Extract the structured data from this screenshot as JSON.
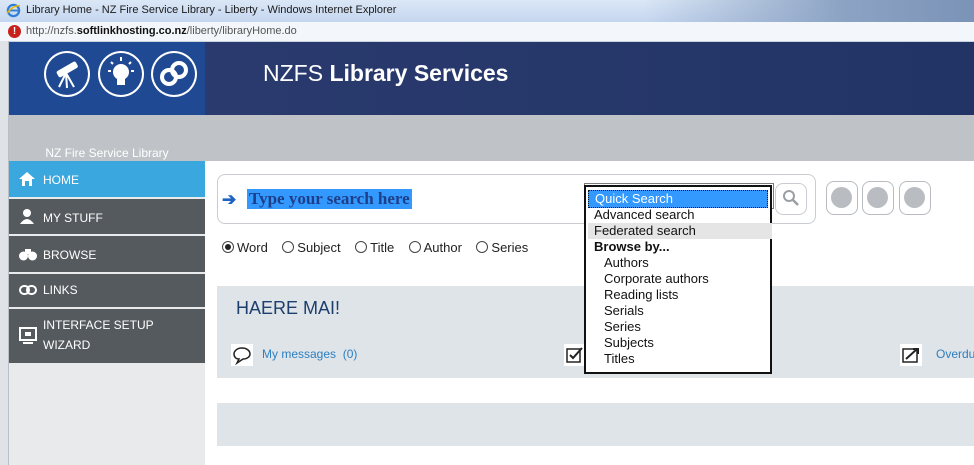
{
  "window": {
    "title": "Library Home - NZ Fire Service Library - Liberty - Windows Internet Explorer",
    "url_prefix": "http://nzfs.",
    "url_domain": "softlinkhosting.co.nz",
    "url_path": "/liberty/libraryHome.do"
  },
  "header": {
    "brand_prefix": "NZFS",
    "brand_main": "Library Services",
    "library_name": "NZ Fire Service Library",
    "logo_icons": [
      "telescope-icon",
      "lightbulb-icon",
      "link-icon"
    ]
  },
  "sidebar": {
    "items": [
      {
        "label": "HOME",
        "icon": "home-icon",
        "active": true
      },
      {
        "label": "MY STUFF",
        "icon": "person-icon"
      },
      {
        "label": "BROWSE",
        "icon": "binoculars-icon"
      },
      {
        "label": "LINKS",
        "icon": "link-icon"
      },
      {
        "label_line1": "INTERFACE SETUP",
        "label_line2": "WIZARD",
        "icon": "monitor-icon"
      }
    ]
  },
  "search": {
    "placeholder": "Type your search here",
    "selected_type": "Quick Search",
    "options": [
      {
        "label": "Quick Search",
        "kind": "option",
        "selected": true
      },
      {
        "label": "Advanced search",
        "kind": "option"
      },
      {
        "label": "Federated search",
        "kind": "option",
        "hover": true
      },
      {
        "label": "Browse by...",
        "kind": "group"
      },
      {
        "label": "Authors",
        "kind": "sub"
      },
      {
        "label": "Corporate authors",
        "kind": "sub"
      },
      {
        "label": "Reading lists",
        "kind": "sub"
      },
      {
        "label": "Serials",
        "kind": "sub"
      },
      {
        "label": "Series",
        "kind": "sub"
      },
      {
        "label": "Subjects",
        "kind": "sub"
      },
      {
        "label": "Titles",
        "kind": "sub"
      }
    ],
    "radio": {
      "word": "Word",
      "subject": "Subject",
      "title": "Title",
      "author": "Author",
      "series": "Series",
      "checked": "Word"
    }
  },
  "welcome": {
    "heading": "HAERE MAI!",
    "messages_label": "My messages",
    "messages_count": "(0)",
    "overdue_label": "Overdu"
  },
  "colors": {
    "header_blue": "#1f4a93",
    "nav_active": "#3aa8df",
    "nav_dark": "#555a5e",
    "highlight": "#3399ff"
  }
}
